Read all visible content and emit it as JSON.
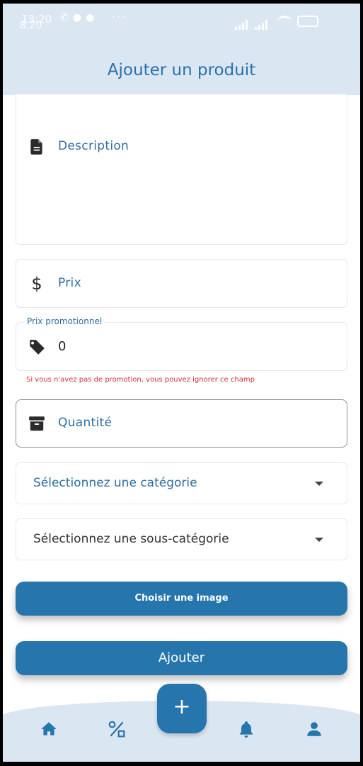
{
  "status_bar": {
    "time": "13:20",
    "time_overlay": "8:20",
    "dots": "···"
  },
  "header": {
    "title": "Ajouter un produit"
  },
  "form": {
    "description": {
      "label": "Description",
      "icon": "document-icon"
    },
    "price": {
      "label": "Prix",
      "icon": "dollar-icon"
    },
    "promo_price": {
      "label": "Prix promotionnel",
      "value": "0",
      "icon": "tag-icon",
      "hint": "Si vous n'avez pas de promotion, vous pouvez ignorer ce champ"
    },
    "quantity": {
      "label": "Quantité",
      "icon": "archive-icon"
    },
    "category": {
      "placeholder": "Sélectionnez une catégorie"
    },
    "subcategory": {
      "placeholder": "Sélectionnez une sous-catégorie"
    },
    "choose_image_label": "Choisir une image",
    "submit_label": "Ajouter"
  },
  "bottom_nav": {
    "fab_label": "+",
    "items": [
      "home-icon",
      "discount-icon",
      "bell-icon",
      "person-icon"
    ]
  },
  "colors": {
    "primary": "#2675ad",
    "header_bg": "#dbe6f3",
    "label": "#2f6f9f",
    "error": "#d2313d"
  }
}
